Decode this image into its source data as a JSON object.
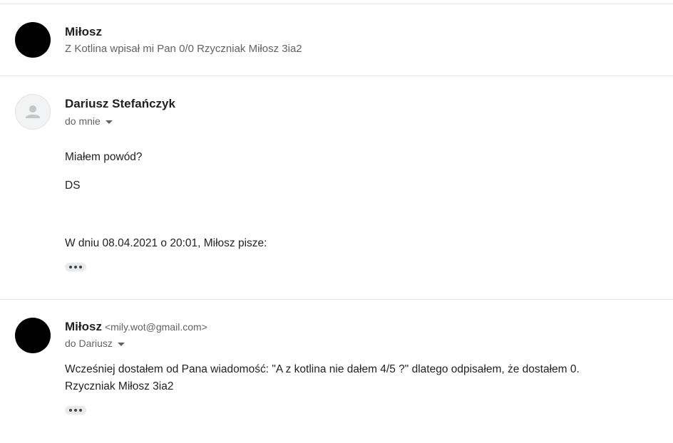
{
  "messages": [
    {
      "sender": "Miłosz",
      "snippet": "Z Kotlina wpisał mi Pan 0/0 Rzyczniak Miłosz 3ia2"
    },
    {
      "sender": "Dariusz Stefańczyk",
      "recipient": "do mnie",
      "body": [
        "Miałem powód?",
        "DS"
      ],
      "quote_header": "W dniu 08.04.2021 o 20:01, Miłosz pisze:"
    },
    {
      "sender": "Miłosz",
      "sender_email": "<mily.wot@gmail.com>",
      "recipient": "do Dariusz",
      "body": [
        "Wcześniej dostałem od Pana wiadomość: \"A z kotlina nie dałem 4/5 ?\" dlatego odpisałem, że dostałem 0.",
        "Rzyczniak Miłosz 3ia2"
      ]
    }
  ],
  "icons": {
    "default_avatar": "person-icon",
    "show_trimmed": "more-horiz-icon",
    "recipient_details": "caret-down-icon"
  }
}
